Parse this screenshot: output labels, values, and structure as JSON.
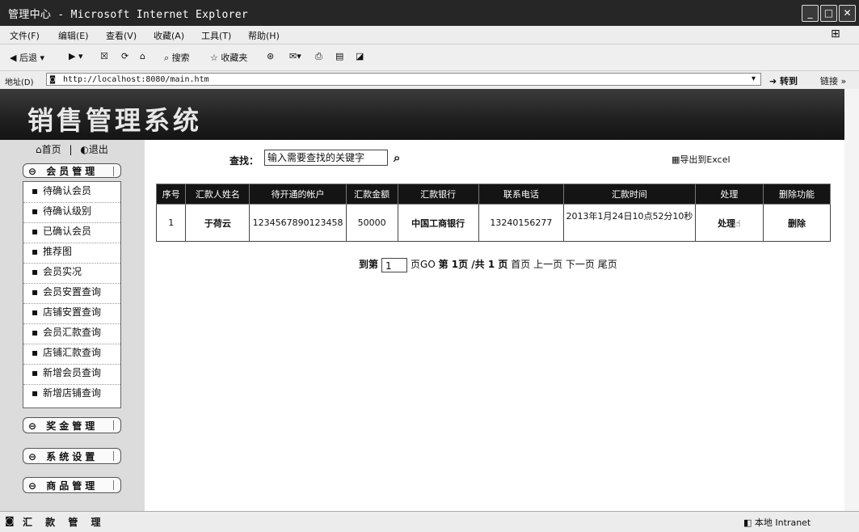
{
  "window": {
    "title": "管理中心 - Microsoft Internet Explorer"
  },
  "menu": [
    "文件(F)",
    "编辑(E)",
    "查看(V)",
    "收藏(A)",
    "工具(T)",
    "帮助(H)"
  ],
  "toolbar": {
    "back": "后退",
    "search": "搜索",
    "favorites": "收藏夹"
  },
  "address": {
    "label": "地址(D)",
    "url": "http://localhost:8080/main.htm",
    "go": "转到",
    "links": "链接"
  },
  "banner": {
    "title": "销售管理系统"
  },
  "topnav": {
    "home": "首页",
    "logout": "退出",
    "separator": "|"
  },
  "sidebar": {
    "groups": [
      "会员管理",
      "奖金管理",
      "系统设置",
      "商品管理"
    ],
    "items": [
      "待确认会员",
      "待确认级别",
      "已确认会员",
      "推荐图",
      "会员实况",
      "会员安置查询",
      "店铺安置查询",
      "会员汇款查询",
      "店铺汇款查询",
      "新增会员查询",
      "新增店铺查询"
    ]
  },
  "search": {
    "label": "查找：",
    "placeholder": "输入需要查找的关键字"
  },
  "export": {
    "label": "导出到Excel"
  },
  "table": {
    "headers": [
      "序号",
      "汇款人姓名",
      "待开通的帐户",
      "汇款金额",
      "汇款银行",
      "联系电话",
      "汇款时间",
      "处理",
      "删除功能"
    ],
    "rows": [
      [
        "1",
        "于荷云",
        "1234567890123458",
        "50000",
        "中国工商银行",
        "13240156277",
        "2013年1月24日10点52分10秒",
        "处理",
        "删除"
      ]
    ]
  },
  "pager": {
    "goto_prefix": "到第",
    "page_value": "1",
    "goto_suffix": "页GO",
    "info": "第 1页 /共 1 页",
    "first": "首页",
    "prev": "上一页",
    "next": "下一页",
    "last": "尾页"
  },
  "status": {
    "left": "汇 款 管 理",
    "zone": "本地 Intranet"
  }
}
